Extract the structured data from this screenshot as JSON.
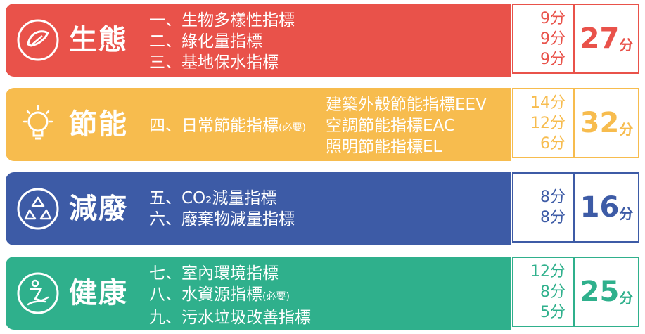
{
  "colors": {
    "eco": "#E9524A",
    "energy": "#F7BC4E",
    "reduce": "#3D5BA6",
    "health": "#2FB08C"
  },
  "rows": [
    {
      "icon": "ecology-icon",
      "category": "生態",
      "items": [
        "一、生物多樣性指標",
        "二、綠化量指標",
        "三、基地保水指標"
      ],
      "scores": [
        "9分",
        "9分",
        "9分"
      ],
      "total": "27",
      "unit": "分"
    },
    {
      "icon": "lightbulb-icon",
      "category": "節能",
      "items": [
        "四、日常節能指標"
      ],
      "item_note": "(必要)",
      "subitems": [
        "建築外殼節能指標EEV",
        "空調節能指標EAC",
        "照明節能指標EL"
      ],
      "scores": [
        "14分",
        "12分",
        "6分"
      ],
      "total": "32",
      "unit": "分"
    },
    {
      "icon": "recycle-icon",
      "category": "減廢",
      "items": [
        "五、CO₂減量指標",
        "六、廢棄物減量指標"
      ],
      "scores": [
        "8分",
        "8分"
      ],
      "total": "16",
      "unit": "分"
    },
    {
      "icon": "health-icon",
      "category": "健康",
      "items": [
        "七、室內環境指標",
        "八、水資源指標",
        "九、污水垃圾改善指標"
      ],
      "item_note": "(必要)",
      "scores": [
        "12分",
        "8分",
        "5分"
      ],
      "total": "25",
      "unit": "分"
    }
  ]
}
